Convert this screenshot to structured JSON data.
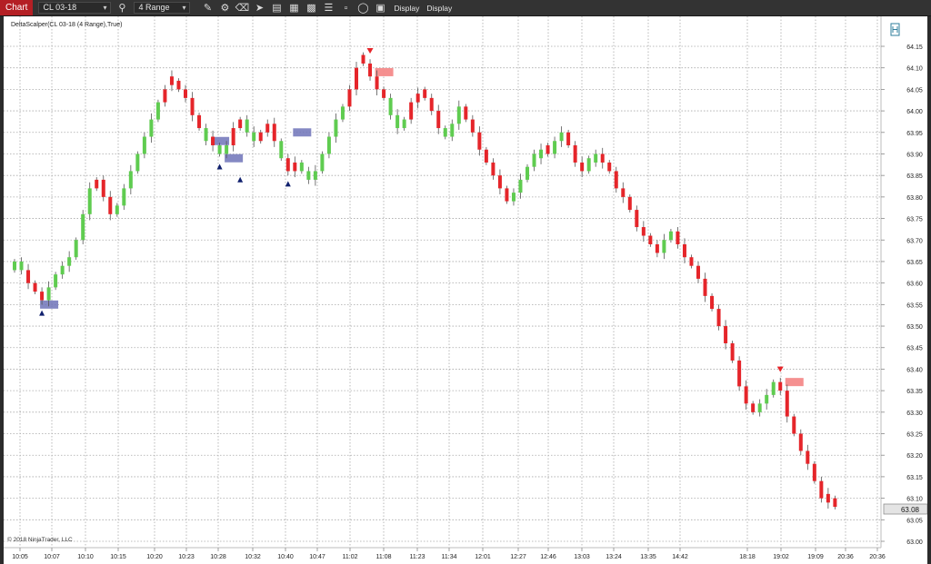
{
  "toolbar": {
    "tab_label": "Chart",
    "instrument": "CL 03-18",
    "interval": "4 Range",
    "display1": "Display",
    "display2": "Display",
    "icons": [
      "search-icon",
      "pencil-icon",
      "zoom-icon",
      "eraser-icon",
      "pointer-icon",
      "notes-icon",
      "bars-icon",
      "grid-icon",
      "properties-icon",
      "indicators-icon",
      "strategy-icon",
      "circle-icon",
      "layout-icon"
    ]
  },
  "chart": {
    "indicator_label": "DeltaScalper(CL 03-18 (4 Range),True)",
    "copyright": "© 2018 NinjaTrader, LLC",
    "current_price": "63.08",
    "colors": {
      "up": "#5fcc50",
      "down": "#e5252a",
      "wick": "#555555",
      "buy_zone": "#6f73b8",
      "sell_zone": "#f48a8a",
      "buy_marker": "#10206e",
      "sell_marker": "#e5252a",
      "grid": "#a8a8a8"
    }
  },
  "chart_data": {
    "type": "candlestick",
    "y_ticks": [
      "64.15",
      "64.10",
      "64.05",
      "64.00",
      "63.95",
      "63.90",
      "63.85",
      "63.80",
      "63.75",
      "63.70",
      "63.65",
      "63.60",
      "63.55",
      "63.50",
      "63.45",
      "63.40",
      "63.35",
      "63.30",
      "63.25",
      "63.20",
      "63.15",
      "63.10",
      "63.05",
      "63.00"
    ],
    "ylim": [
      63.0,
      64.15
    ],
    "x_ticks": [
      "10:05",
      "10:07",
      "10:10",
      "10:15",
      "10:20",
      "10:23",
      "10:28",
      "10:32",
      "10:40",
      "10:47",
      "11:02",
      "11:08",
      "11:23",
      "11:34",
      "12:01",
      "12:27",
      "12:46",
      "13:03",
      "13:24",
      "13:35",
      "14:42",
      "18:18",
      "19:02",
      "19:09",
      "20:36",
      "20:36"
    ],
    "closes": [
      63.65,
      63.63,
      63.6,
      63.58,
      63.56,
      63.59,
      63.62,
      63.64,
      63.66,
      63.7,
      63.76,
      63.82,
      63.84,
      63.8,
      63.76,
      63.78,
      63.82,
      63.86,
      63.9,
      63.94,
      63.98,
      64.02,
      64.05,
      64.06,
      64.05,
      64.03,
      63.99,
      63.96,
      63.93,
      63.92,
      63.9,
      63.92,
      63.96,
      63.98,
      63.95,
      63.93,
      63.95,
      63.97,
      63.93,
      63.89,
      63.86,
      63.88,
      63.86,
      63.84,
      63.86,
      63.9,
      63.94,
      63.98,
      64.01,
      64.05,
      64.1,
      64.11,
      64.08,
      64.05,
      64.03,
      63.99,
      63.96,
      63.98,
      64.02,
      64.04,
      64.03,
      64.0,
      63.96,
      63.94,
      63.97,
      64.01,
      63.98,
      63.95,
      63.91,
      63.88,
      63.85,
      63.82,
      63.79,
      63.81,
      63.84,
      63.87,
      63.9,
      63.91,
      63.9,
      63.93,
      63.95,
      63.92,
      63.88,
      63.86,
      63.89,
      63.9,
      63.88,
      63.86,
      63.82,
      63.8,
      63.77,
      63.73,
      63.71,
      63.69,
      63.67,
      63.7,
      63.72,
      63.69,
      63.66,
      63.64,
      63.61,
      63.57,
      63.54,
      63.5,
      63.46,
      63.42,
      63.36,
      63.32,
      63.3,
      63.32,
      63.34,
      63.37,
      63.35,
      63.29,
      63.25,
      63.21,
      63.18,
      63.14,
      63.1,
      63.09,
      63.08
    ],
    "directions": "UUDDDUUUUUUUDDDUUUUUUUDDDDDDUDUUDDUUDDDUDDUUUUUUUDDDDDDUUUDDDDDUUUDDDDDDDUUUUUDUUDDDUUDDDDDDDDDUUDDDDDDDDDDDDUUUDDDDDDDD",
    "signals": [
      {
        "type": "buy",
        "index": 4,
        "price": 63.56
      },
      {
        "type": "buy",
        "index": 30,
        "price": 63.9
      },
      {
        "type": "buy",
        "index": 33,
        "price": 63.87
      },
      {
        "type": "buy",
        "index": 40,
        "price": 63.86
      },
      {
        "type": "sell",
        "index": 52,
        "price": 64.11
      },
      {
        "type": "sell",
        "index": 112,
        "price": 63.37
      }
    ],
    "zones": [
      {
        "type": "buy",
        "start_index": 4,
        "price": 63.55
      },
      {
        "type": "buy",
        "start_index": 29,
        "price": 63.93
      },
      {
        "type": "buy",
        "start_index": 31,
        "price": 63.89
      },
      {
        "type": "buy",
        "start_index": 41,
        "price": 63.95
      },
      {
        "type": "sell",
        "start_index": 53,
        "price": 64.09
      },
      {
        "type": "sell",
        "start_index": 113,
        "price": 63.37
      }
    ]
  }
}
